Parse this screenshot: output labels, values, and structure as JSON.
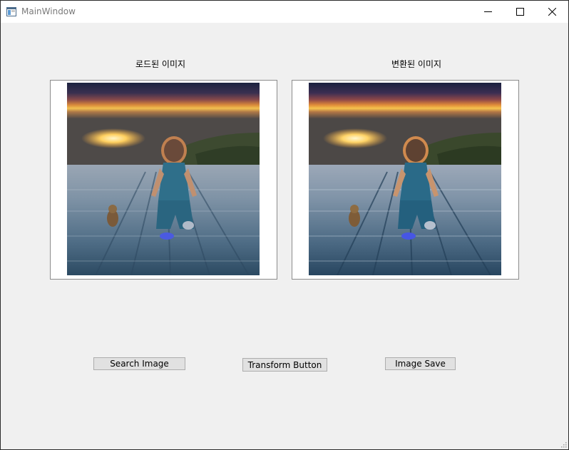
{
  "window": {
    "title": "MainWindow"
  },
  "labels": {
    "loaded": "로드된 이미지",
    "transformed": "변환된 이미지"
  },
  "buttons": {
    "search": "Search Image",
    "transform": "Transform Button",
    "save": "Image Save"
  },
  "icons": {
    "app": "app-window-icon",
    "minimize": "minimize-icon",
    "maximize": "maximize-icon",
    "close": "close-icon",
    "grip": "size-grip-icon"
  },
  "colors": {
    "background": "#f0f0f0",
    "titlebar": "#ffffff",
    "button_face": "#e1e1e1",
    "button_border": "#adadad"
  }
}
